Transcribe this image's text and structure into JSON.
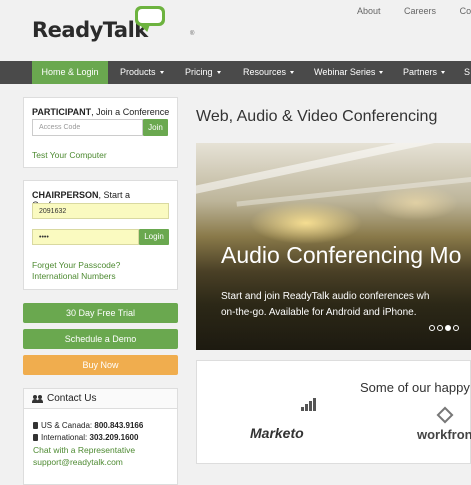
{
  "brand": {
    "name": "ReadyTalk",
    "registered": "®",
    "accent": "#6aa84f"
  },
  "toplinks": [
    "About",
    "Careers",
    "Con"
  ],
  "nav": {
    "items": [
      {
        "label": "Home & Login",
        "active": true,
        "caret": false
      },
      {
        "label": "Products",
        "caret": true
      },
      {
        "label": "Pricing",
        "caret": true
      },
      {
        "label": "Resources",
        "caret": true
      },
      {
        "label": "Webinar Series",
        "caret": true
      },
      {
        "label": "Partners",
        "caret": true
      },
      {
        "label": "S",
        "caret": false
      }
    ]
  },
  "participant": {
    "title_bold": "PARTICIPANT",
    "title_rest": ", Join a Conference",
    "access_placeholder": "Access Code",
    "join_label": "Join",
    "test_link": "Test Your Computer"
  },
  "chairperson": {
    "title_bold": "CHAIRPERSON",
    "title_rest": ", Start a Conference",
    "number_value": "2091632",
    "passcode_value": "••••",
    "login_label": "Login",
    "forgot_link": "Forget Your Passcode?",
    "intl_link": "International Numbers"
  },
  "actions": {
    "trial": "30 Day Free Trial",
    "demo": "Schedule a Demo",
    "buy": "Buy Now"
  },
  "contact": {
    "title": "Contact Us",
    "us_label": "US & Canada:",
    "us_number": "800.843.9166",
    "intl_label": "International:",
    "intl_number": "303.209.1600",
    "chat_link": "Chat with a Representative",
    "email_link": "support@readytalk.com"
  },
  "main": {
    "heading": "Web, Audio & Video Conferencing",
    "hero_title": "Audio Conferencing Mo",
    "hero_line1": "Start and join ReadyTalk audio conferences wh",
    "hero_line2": "on-the-go.  Available for Android and iPhone.",
    "slides_active_index": 3,
    "slides_count": 4,
    "customers_title": "Some of our happy",
    "logos": [
      "Marketo",
      "workfron"
    ]
  }
}
